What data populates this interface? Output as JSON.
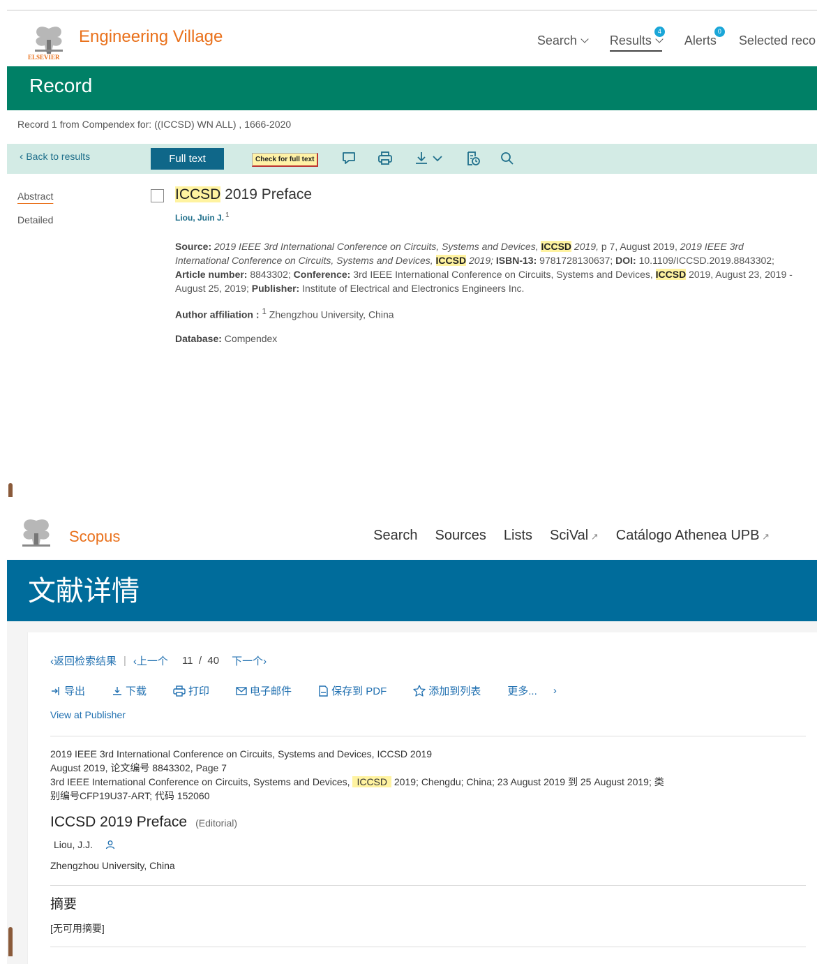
{
  "ev": {
    "brand": "Engineering Village",
    "logo_text": "ELSEVIER",
    "nav": {
      "search": "Search",
      "results": "Results",
      "results_badge": "4",
      "alerts": "Alerts",
      "alerts_badge": "0",
      "selected": "Selected reco"
    },
    "banner_title": "Record",
    "crumb": "Record 1 from Compendex for: ((ICCSD) WN ALL) , 1666-2020",
    "toolbar": {
      "back": "Back to results",
      "full_text": "Full text",
      "check_full_text": "Check for full text"
    },
    "side": {
      "abstract": "Abstract",
      "detailed": "Detailed"
    },
    "record": {
      "title_hl": "ICCSD",
      "title_rest": " 2019 Preface",
      "author": "Liou, Juin J.",
      "author_sup": "1",
      "source_label": "Source:",
      "source_1": "2019 IEEE 3rd International Conference on Circuits, Systems and Devices,",
      "hl": "ICCSD",
      "source_2": " 2019,",
      "source_3": " p 7, August 2019,",
      "source_4": " 2019 IEEE 3rd International Conference on Circuits, Systems and Devices,",
      "source_5": " 2019;",
      "isbn_label": " ISBN-13:",
      "isbn": " 9781728130637;",
      "doi_label": " DOI:",
      "doi": " 10.1109/ICCSD.2019.8843302;",
      "art_label": " Article number:",
      "art": " 8843302;",
      "conf_label": " Conference:",
      "conf_1": " 3rd IEEE International Conference on Circuits, Systems and Devices,",
      "conf_2": " 2019, August 23, 2019 - August 25, 2019;",
      "pub_label": " Publisher:",
      "pub": " Institute of Electrical and Electronics Engineers Inc.",
      "aff_label": "Author affiliation :",
      "aff_sup": "1",
      "aff": " Zhengzhou University, China",
      "db_label": "Database:",
      "db": " Compendex"
    }
  },
  "sc": {
    "brand": "Scopus",
    "nav": {
      "search": "Search",
      "sources": "Sources",
      "lists": "Lists",
      "scival": "SciVal",
      "catalogo": "Catálogo Athenea UPB"
    },
    "banner_title": "文献详情",
    "pager": {
      "back": "返回检索结果",
      "prev": "上一个",
      "current": "11",
      "slash": "/",
      "total": "40",
      "next": "下一个"
    },
    "actions": {
      "export": "导出",
      "download": "下载",
      "print": "打印",
      "email": "电子邮件",
      "pdf": "保存到 PDF",
      "add": "添加到列表",
      "more": "更多..."
    },
    "view_publisher": "View at Publisher",
    "source": {
      "line1": "2019 IEEE 3rd International Conference on Circuits, Systems and Devices, ICCSD 2019",
      "line2": "August 2019, 论文编号 8843302, Page 7",
      "line3a": "3rd IEEE International Conference on Circuits, Systems and Devices, ",
      "hl": "ICCSD",
      "line3b": " 2019; Chengdu; China; 23 August 2019 到 25 August 2019; 类别编号CFP19U37-ART; 代码 152060"
    },
    "title": "ICCSD 2019 Preface",
    "doc_type": "(Editorial)",
    "author": "Liou, J.J.",
    "affiliation": "Zhengzhou University, China",
    "abstract_heading": "摘要",
    "abstract_text": "[无可用摘要]"
  },
  "colors": {
    "ev_banner": "#008066",
    "ev_toolbar": "#d3ebe5",
    "ev_brand": "#e9711c",
    "sc_banner": "#006c9b",
    "link": "#1f6fb0",
    "highlight": "#fff3a0"
  },
  "icons": [
    "comment-icon",
    "print-icon",
    "download-icon",
    "bookmark-clock-icon",
    "search-icon",
    "user-icon"
  ]
}
